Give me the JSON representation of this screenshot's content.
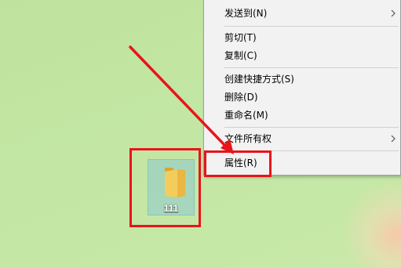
{
  "context_menu": {
    "items": [
      {
        "label": "发送到(N)",
        "submenu": true
      },
      {
        "label": "剪切(T)",
        "submenu": false
      },
      {
        "label": "复制(C)",
        "submenu": false
      },
      {
        "label": "创建快捷方式(S)",
        "submenu": false
      },
      {
        "label": "删除(D)",
        "submenu": false
      },
      {
        "label": "重命名(M)",
        "submenu": false
      },
      {
        "label": "文件所有权",
        "submenu": true
      },
      {
        "label": "属性(R)",
        "submenu": false
      }
    ]
  },
  "desktop": {
    "icon": {
      "label": "111",
      "icon": "folder-icon"
    }
  },
  "annotations": {
    "color": "#e8141b"
  },
  "colors": {
    "menu_bg": "#f2f2f2",
    "desktop_bg": "#c3e6a4",
    "folder": "#f0c24d"
  }
}
